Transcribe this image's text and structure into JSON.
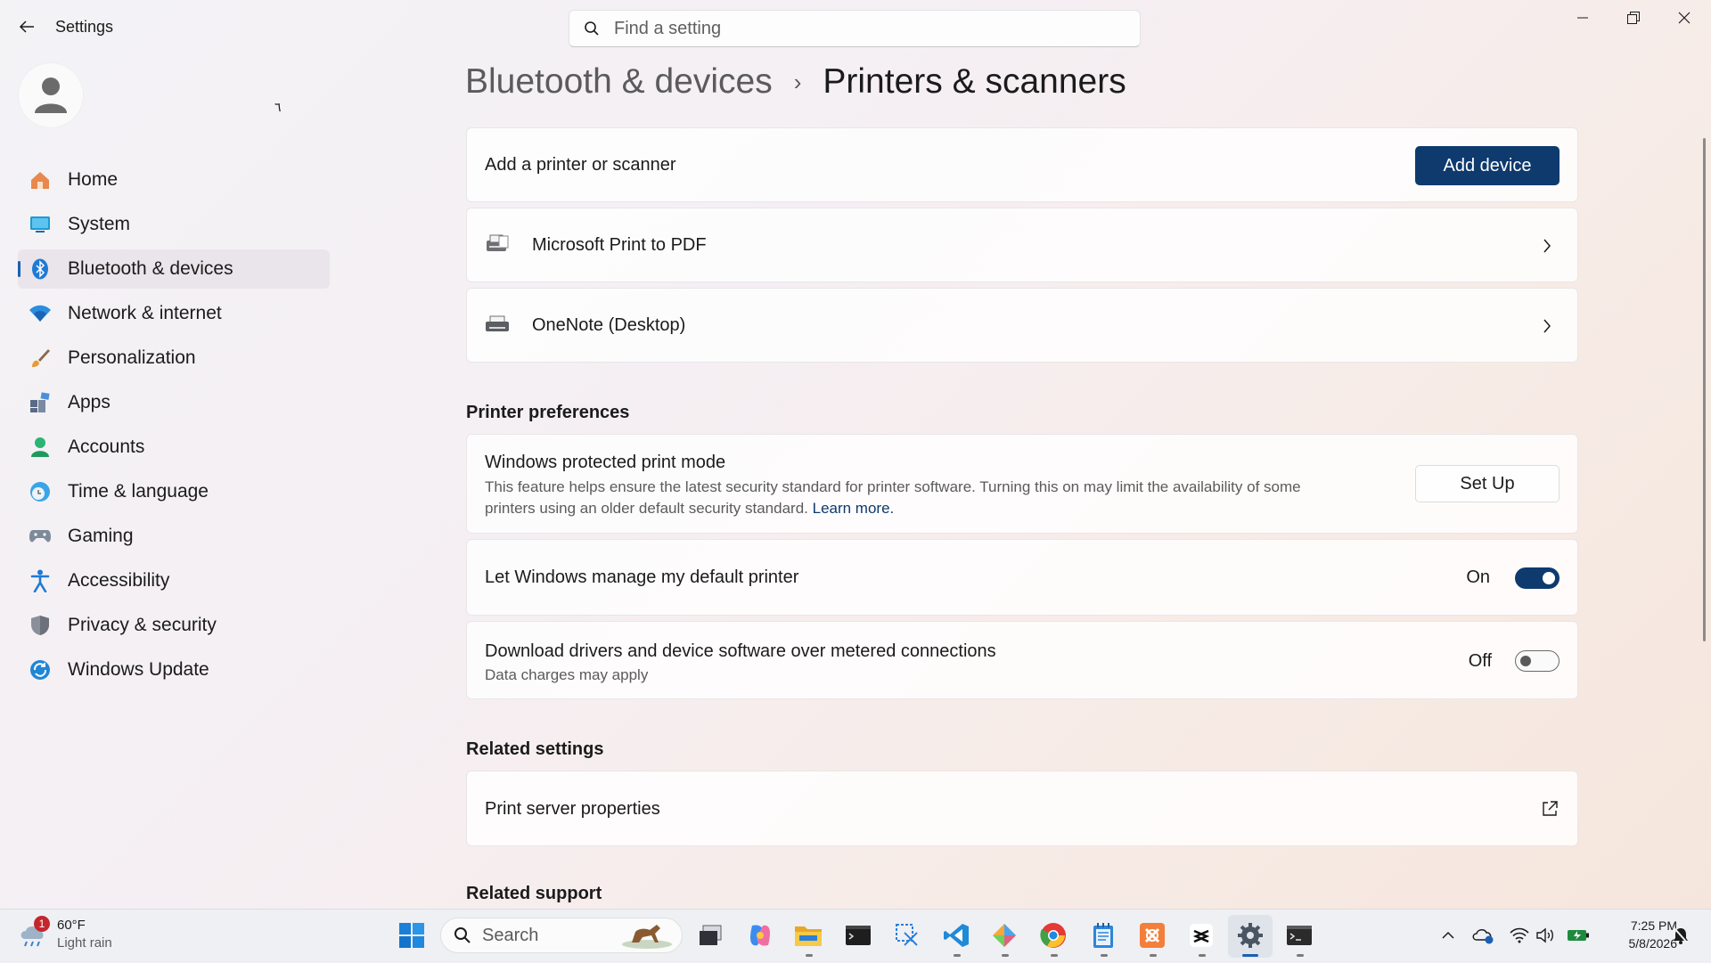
{
  "window": {
    "title": "Settings",
    "search_placeholder": "Find a setting"
  },
  "user": {
    "mark": "٦"
  },
  "sidebar": {
    "items": [
      {
        "label": "Home",
        "icon": "home-icon"
      },
      {
        "label": "System",
        "icon": "system-icon"
      },
      {
        "label": "Bluetooth & devices",
        "icon": "bluetooth-icon",
        "selected": true
      },
      {
        "label": "Network & internet",
        "icon": "wifi-icon"
      },
      {
        "label": "Personalization",
        "icon": "brush-icon"
      },
      {
        "label": "Apps",
        "icon": "apps-icon"
      },
      {
        "label": "Accounts",
        "icon": "accounts-icon"
      },
      {
        "label": "Time & language",
        "icon": "clock-globe-icon"
      },
      {
        "label": "Gaming",
        "icon": "gamepad-icon"
      },
      {
        "label": "Accessibility",
        "icon": "accessibility-icon"
      },
      {
        "label": "Privacy & security",
        "icon": "shield-icon"
      },
      {
        "label": "Windows Update",
        "icon": "update-icon"
      }
    ]
  },
  "breadcrumb": {
    "parent": "Bluetooth & devices",
    "separator": "›",
    "current": "Printers & scanners"
  },
  "add_printer": {
    "label": "Add a printer or scanner",
    "button": "Add device"
  },
  "printers": [
    {
      "name": "Microsoft Print to PDF"
    },
    {
      "name": "OneNote (Desktop)"
    }
  ],
  "printer_preferences": {
    "heading": "Printer preferences",
    "protected_mode": {
      "title": "Windows protected print mode",
      "desc_line1": "This feature helps ensure the latest security standard for printer software. Turning this on may limit the availability of some",
      "desc_line2": "printers using an older default security standard.",
      "link": "Learn more.",
      "button": "Set Up"
    },
    "manage_default": {
      "title": "Let Windows manage my default printer",
      "state_label": "On",
      "on": true
    },
    "metered": {
      "title": "Download drivers and device software over metered connections",
      "subtitle": "Data charges may apply",
      "state_label": "Off",
      "on": false
    }
  },
  "related_settings": {
    "heading": "Related settings",
    "items": [
      {
        "label": "Print server properties"
      }
    ]
  },
  "related_support": {
    "heading": "Related support"
  },
  "taskbar": {
    "weather_temp": "60°F",
    "weather_desc": "Light rain",
    "weather_badge": "1",
    "search_label": "Search",
    "clock_time": "7:25 PM",
    "clock_date": "5/8/2026"
  },
  "colors": {
    "accent": "#0e3a6e",
    "selection_bar": "#1a5fb4"
  }
}
